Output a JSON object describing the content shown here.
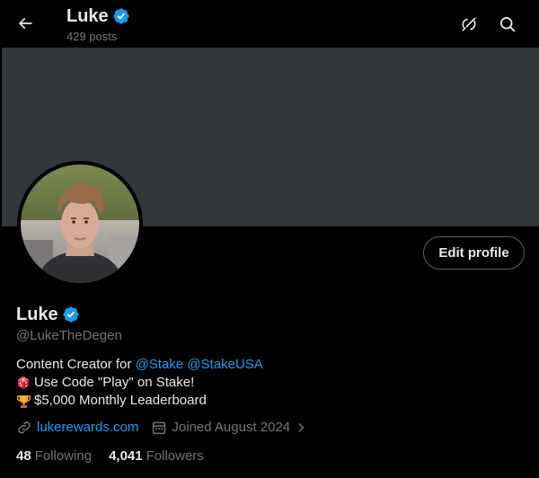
{
  "header": {
    "title": "Luke",
    "posts_label": "429 posts"
  },
  "profile": {
    "name": "Luke",
    "handle": "@LukeTheDegen",
    "edit_button_label": "Edit profile",
    "bio": {
      "line1_prefix": "Content Creator for ",
      "mention1": "@Stake",
      "mention2": "@StakeUSA",
      "line2": "Use Code \"Play\" on Stake!",
      "line3": "$5,000 Monthly Leaderboard"
    },
    "website": "lukerewards.com",
    "joined": "Joined August 2024",
    "following_count": "48",
    "following_label": "Following",
    "followers_count": "4,041",
    "followers_label": "Followers"
  },
  "icons": {
    "back": "arrow-left-icon",
    "grok": "grok-icon",
    "search": "search-icon",
    "verified": "verified-badge-icon",
    "dice": "dice-emoji",
    "trophy": "trophy-emoji",
    "link": "link-icon",
    "calendar": "calendar-icon",
    "chevron": "chevron-right-icon"
  },
  "colors": {
    "background": "#000000",
    "banner": "#33373a",
    "accent": "#1d9bf0",
    "text": "#e7e9ea",
    "muted": "#71767b"
  }
}
